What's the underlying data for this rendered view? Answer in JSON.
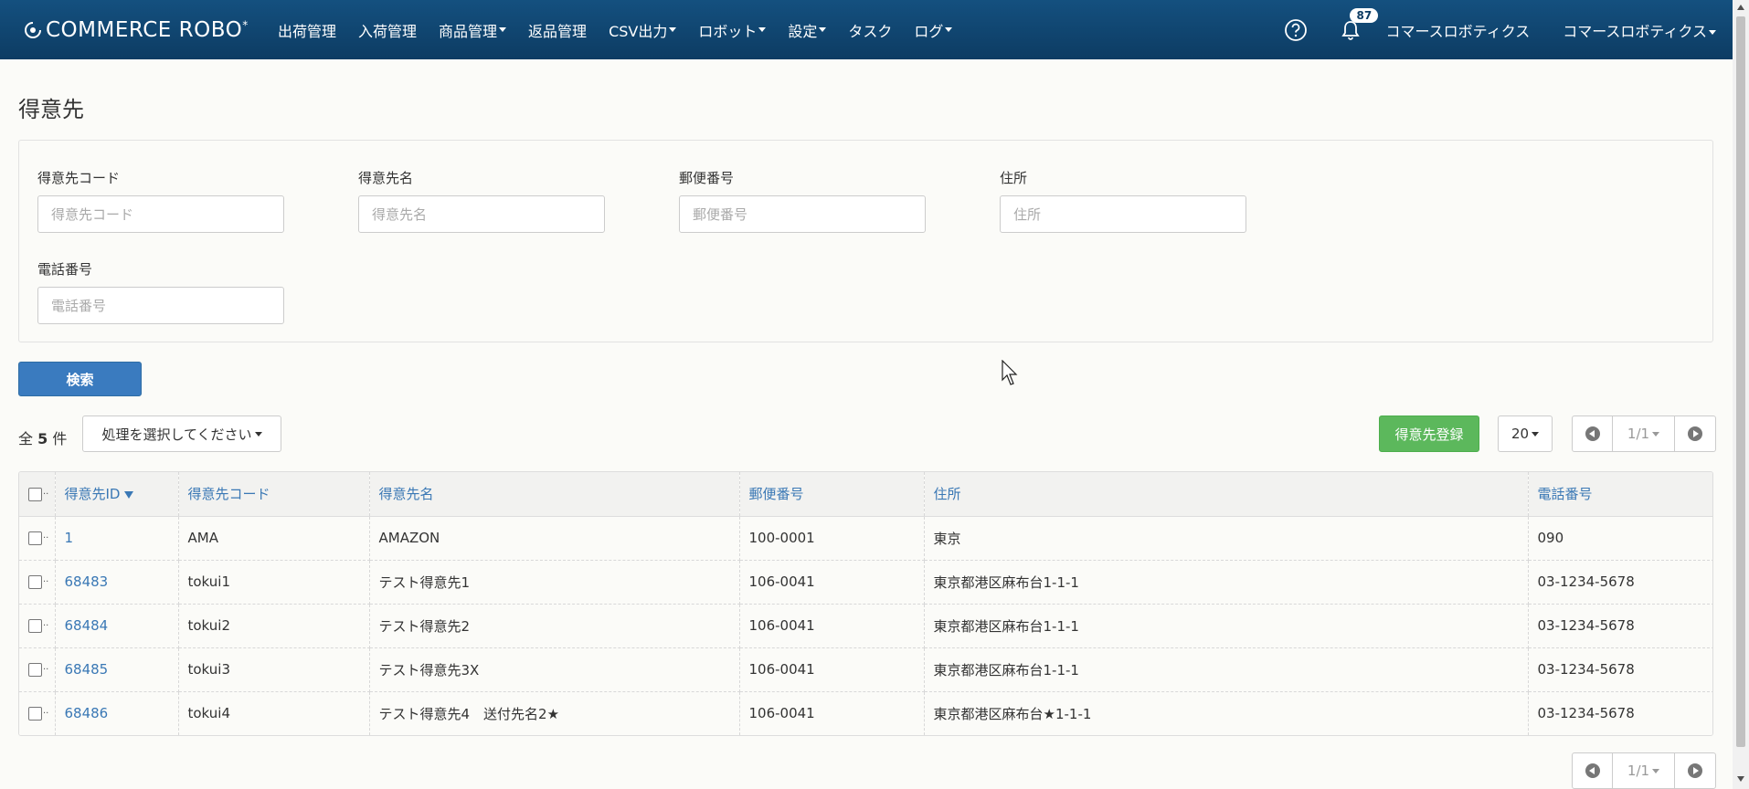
{
  "brand": {
    "name": "COMMERCE ROBO",
    "mark": "*"
  },
  "nav": {
    "items": [
      {
        "label": "出荷管理",
        "dropdown": false
      },
      {
        "label": "入荷管理",
        "dropdown": false
      },
      {
        "label": "商品管理",
        "dropdown": true
      },
      {
        "label": "返品管理",
        "dropdown": false
      },
      {
        "label": "CSV出力",
        "dropdown": true
      },
      {
        "label": "ロボット",
        "dropdown": true
      },
      {
        "label": "設定",
        "dropdown": true
      },
      {
        "label": "タスク",
        "dropdown": false
      },
      {
        "label": "ログ",
        "dropdown": true
      }
    ],
    "notification_count": "87",
    "company_label": "コマースロボティクス",
    "user_label": "コマースロボティクス"
  },
  "page": {
    "title": "得意先"
  },
  "search": {
    "fields": [
      {
        "label": "得意先コード",
        "placeholder": "得意先コード",
        "value": ""
      },
      {
        "label": "得意先名",
        "placeholder": "得意先名",
        "value": ""
      },
      {
        "label": "郵便番号",
        "placeholder": "郵便番号",
        "value": ""
      },
      {
        "label": "住所",
        "placeholder": "住所",
        "value": ""
      },
      {
        "label": "電話番号",
        "placeholder": "電話番号",
        "value": ""
      }
    ],
    "button_label": "検索"
  },
  "toolbar": {
    "total_prefix": "全",
    "total_count": "5",
    "total_suffix": "件",
    "action_select": "処理を選択してください",
    "register_label": "得意先登録",
    "per_page": "20",
    "page_indicator": "1/1"
  },
  "table": {
    "headers": [
      "得意先ID",
      "得意先コード",
      "得意先名",
      "郵便番号",
      "住所",
      "電話番号"
    ],
    "sort_column": "得意先ID",
    "rows": [
      [
        "1",
        "AMA",
        "AMAZON",
        "100-0001",
        "東京",
        "090"
      ],
      [
        "68483",
        "tokui1",
        "テスト得意先1",
        "106-0041",
        "東京都港区麻布台1-1-1",
        "03-1234-5678"
      ],
      [
        "68484",
        "tokui2",
        "テスト得意先2",
        "106-0041",
        "東京都港区麻布台1-1-1",
        "03-1234-5678"
      ],
      [
        "68485",
        "tokui3",
        "テスト得意先3X",
        "106-0041",
        "東京都港区麻布台1-1-1",
        "03-1234-5678"
      ],
      [
        "68486",
        "tokui4",
        "テスト得意先4　送付先名2★",
        "106-0041",
        "東京都港区麻布台★1-1-1",
        "03-1234-5678"
      ]
    ]
  },
  "colors": {
    "navbar": "#0d3c63",
    "primary": "#3a7bbf",
    "success": "#5cb85c",
    "link": "#3a78b5"
  }
}
